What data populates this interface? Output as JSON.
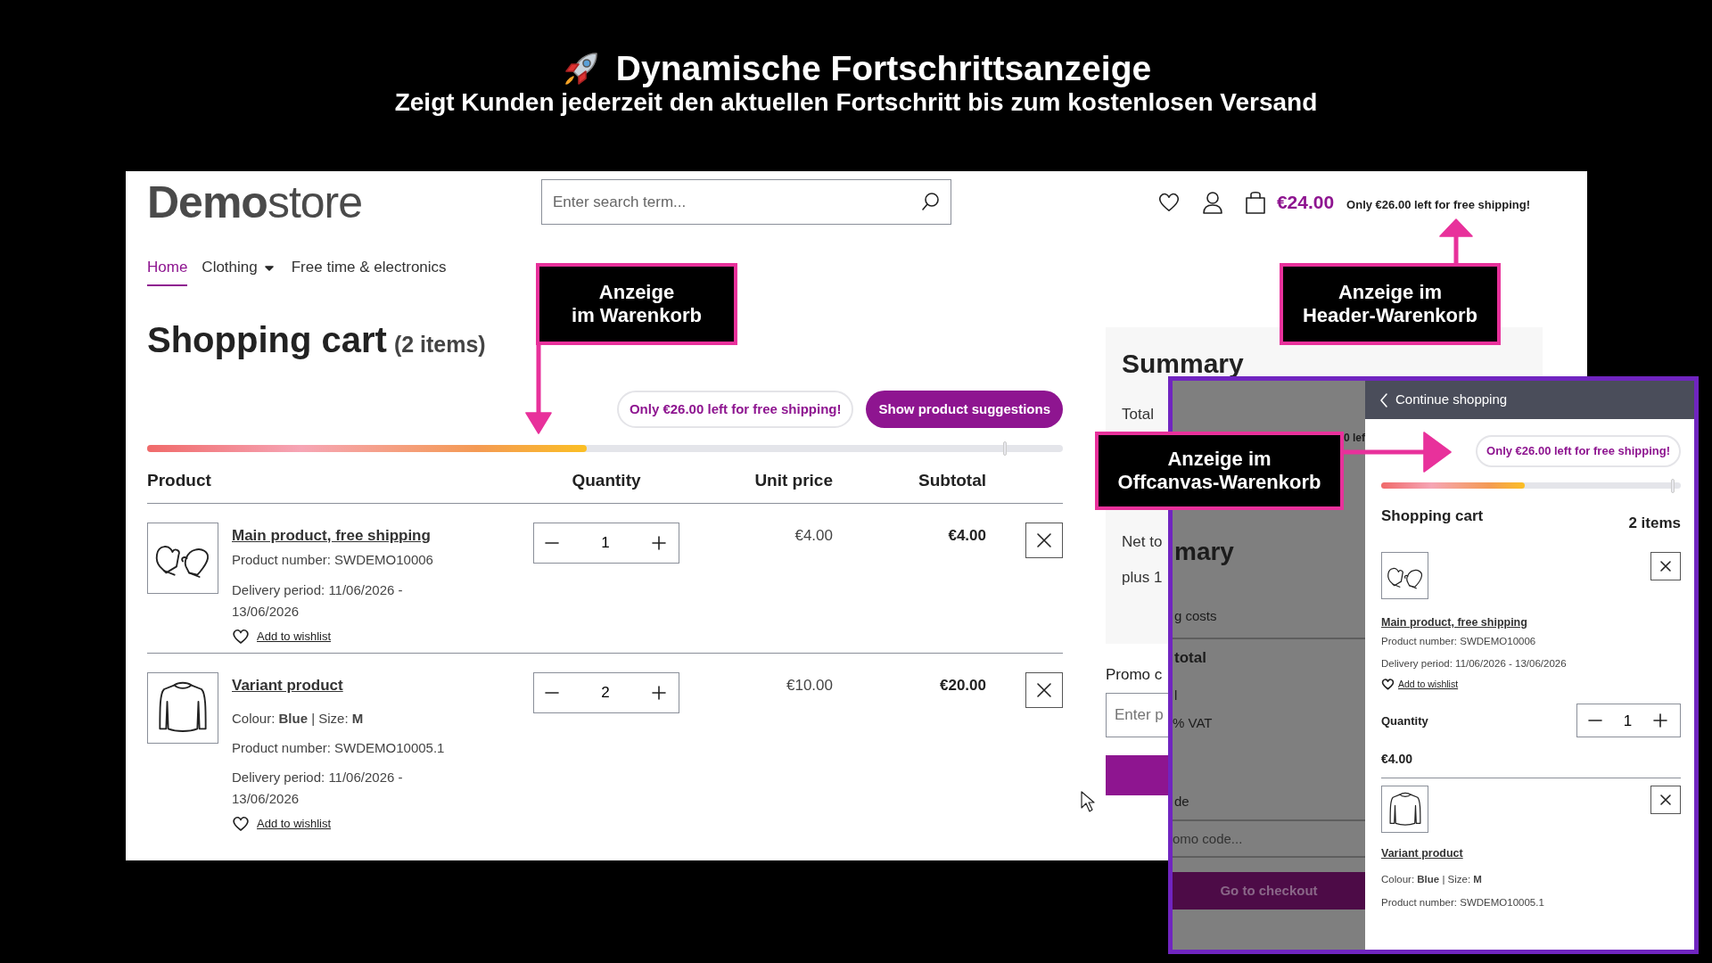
{
  "banner": {
    "title": "Dynamische Fortschrittsanzeige",
    "subtitle": "Zeigt Kunden jederzeit den aktuellen Fortschritt bis zum kostenlosen Versand"
  },
  "shop": {
    "logo": "**Demo**store",
    "search": {
      "placeholder": "Enter search term..."
    },
    "header_cart": {
      "total": "€24.00",
      "notice": "Only €26.00 left for free shipping!"
    },
    "nav": [
      {
        "label": "Home",
        "selected": true,
        "dropdown": false
      },
      {
        "label": "Clothing",
        "selected": false,
        "dropdown": true
      },
      {
        "label": "Free time & electronics",
        "selected": false,
        "dropdown": false
      }
    ],
    "heading": "Shopping cart",
    "count": "(2 items)",
    "notice": "Only €26.00 left for free shipping!",
    "suggestions_button": "Show product suggestions",
    "progress": {
      "level": 0.48
    },
    "columns": [
      "Product",
      "Quantity",
      "Unit price",
      "Subtotal"
    ],
    "items": [
      {
        "name": "Main product, free shipping",
        "details": [
          "Product number: SWDEMO10006"
        ],
        "delivery": [
          "Delivery period: 11/06/2026 -",
          "13/06/2026"
        ],
        "wishlist": "Add to wishlist",
        "quantity": "1",
        "unit_price": "€4.00",
        "subtotal": "€4.00"
      },
      {
        "name": "Variant product",
        "details": [
          "Colour: **Blue** | Size: **M**",
          "Product number: SWDEMO10005.1"
        ],
        "delivery": [
          "Delivery period: 11/06/2026 -",
          "13/06/2026"
        ],
        "wishlist": "Add to wishlist",
        "quantity": "2",
        "unit_price": "€10.00",
        "subtotal": "€20.00"
      }
    ],
    "summary": {
      "title": "Summary",
      "rows": [
        "Total",
        "Net to",
        "plus 1"
      ],
      "promo_label": "Promo c",
      "promo_placeholder": "Enter p"
    }
  },
  "dimmed_page": {
    "header_fragment": "0 lef",
    "heading": "mary",
    "shipping": "g costs",
    "total": "total",
    "row": "l",
    "vat": "% VAT",
    "promo_label": "de",
    "promo_placeholder": "omo code...",
    "checkout": "Go to checkout"
  },
  "offcanvas": {
    "back": "Continue shopping",
    "notice": "Only €26.00 left for free shipping!",
    "progress": {
      "level": 0.48
    },
    "title": "Shopping cart",
    "count": "2 items",
    "items": [
      {
        "name": "Main product, free shipping",
        "details": [
          "Product number: SWDEMO10006",
          "Delivery period: 11/06/2026 - 13/06/2026"
        ],
        "wishlist": "Add to wishlist",
        "quantity_label": "Quantity",
        "quantity": "1",
        "price": "€4.00"
      },
      {
        "name": "Variant product",
        "details": [
          "Colour: **Blue** | Size: **M**",
          "Product number: SWDEMO10005.1"
        ]
      }
    ]
  },
  "callouts": [
    {
      "lines": [
        "Anzeige",
        "im Warenkorb"
      ]
    },
    {
      "lines": [
        "Anzeige im",
        "Header-Warenkorb"
      ]
    },
    {
      "lines": [
        "Anzeige im",
        "Offcanvas-Warenkorb"
      ]
    }
  ]
}
